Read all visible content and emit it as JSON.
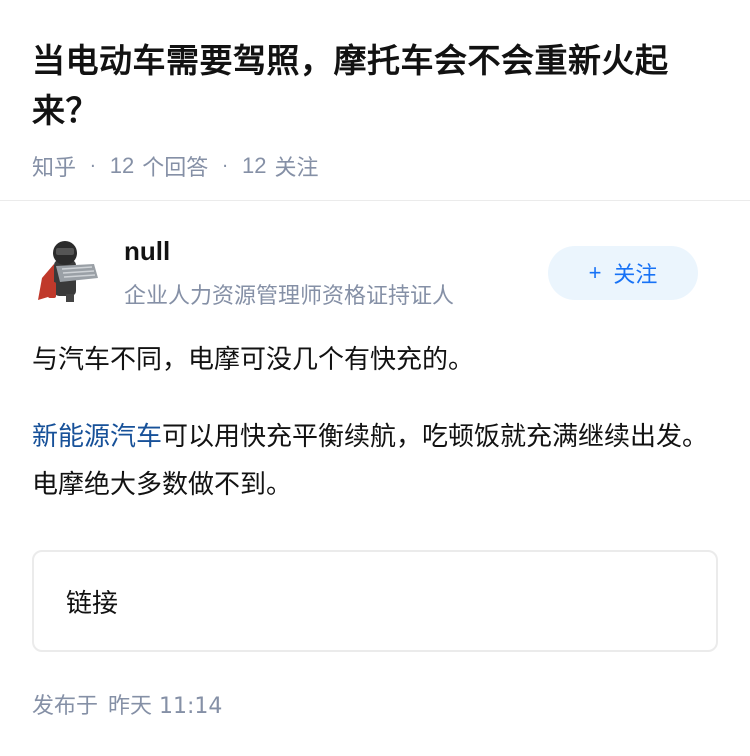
{
  "question": {
    "title": "当电动车需要驾照，摩托车会不会重新火起来？",
    "source": "知乎",
    "answer_count": "12",
    "answer_label": "个回答",
    "follower_count": "12",
    "follower_label": "关注"
  },
  "author": {
    "name": "null",
    "bio": "企业人力资源管理师资格证持证人",
    "follow_label": "关注",
    "follow_icon": "plus-icon"
  },
  "answer": {
    "paragraph1": "与汽车不同，电摩可没几个有快充的。",
    "paragraph2_link": "新能源汽车",
    "paragraph2_text": "可以用快充平衡续航，吃顿饭就充满继续出发。电摩绝大多数做不到。"
  },
  "link_card": {
    "label": "链接"
  },
  "publish": {
    "prefix": "发布于",
    "time": "昨天 11:14"
  },
  "colors": {
    "meta_gray": "#8590a6",
    "link_blue": "#175199",
    "follow_blue": "#1772f6",
    "follow_bg": "#ebf5fd"
  }
}
